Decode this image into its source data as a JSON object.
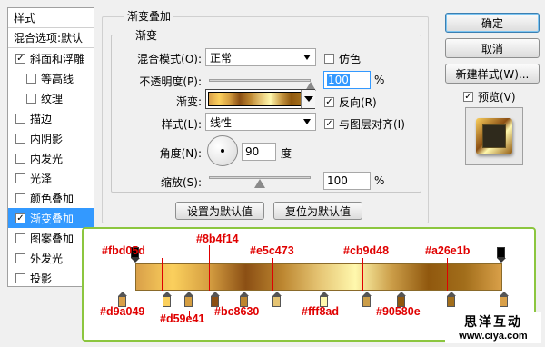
{
  "left_panel": {
    "header": "样式",
    "blend_defaults": "混合选项:默认",
    "items": [
      {
        "label": "斜面和浮雕",
        "checked": "✓",
        "sub": false
      },
      {
        "label": "等高线",
        "checked": "",
        "sub": true
      },
      {
        "label": "纹理",
        "checked": "",
        "sub": true
      },
      {
        "label": "描边",
        "checked": "",
        "sub": false
      },
      {
        "label": "内阴影",
        "checked": "",
        "sub": false
      },
      {
        "label": "内发光",
        "checked": "",
        "sub": false
      },
      {
        "label": "光泽",
        "checked": "",
        "sub": false
      },
      {
        "label": "颜色叠加",
        "checked": "",
        "sub": false
      },
      {
        "label": "渐变叠加",
        "checked": "✓",
        "sub": false,
        "selected": true
      },
      {
        "label": "图案叠加",
        "checked": "",
        "sub": false
      },
      {
        "label": "外发光",
        "checked": "",
        "sub": false
      },
      {
        "label": "投影",
        "checked": "",
        "sub": false
      }
    ]
  },
  "gradient_overlay": {
    "title": "渐变叠加",
    "group_title": "渐变",
    "blend_mode_label": "混合模式(O):",
    "blend_mode_value": "正常",
    "dither_label": "仿色",
    "dither_checked": "",
    "opacity_label": "不透明度(P):",
    "opacity_value": "100",
    "opacity_unit": "%",
    "opacity_level": 1.0,
    "gradient_label": "渐变:",
    "reverse_label": "反向(R)",
    "reverse_checked": "✓",
    "style_label": "样式(L):",
    "style_value": "线性",
    "align_label": "与图层对齐(I)",
    "align_checked": "✓",
    "angle_label": "角度(N):",
    "angle_value": "90",
    "angle_unit": "度",
    "scale_label": "缩放(S):",
    "scale_value": "100",
    "scale_unit": "%",
    "scale_level": 0.5,
    "make_default": "设置为默认值",
    "reset_default": "复位为默认值"
  },
  "right_panel": {
    "ok": "确定",
    "cancel": "取消",
    "new_style": "新建样式(W)...",
    "preview_label": "预览(V)",
    "preview_checked": "✓"
  },
  "gradient_editor": {
    "top_labels": [
      "#fbd05d",
      "#8b4f14",
      "#e5c473",
      "#cb9d48",
      "#a26e1b"
    ],
    "bottom_labels": [
      "#d9a049",
      "#d59e41",
      "#bc8630",
      "#fff8ad",
      "#90580e"
    ],
    "color_stops": [
      "#d9a049",
      "#fbd05d",
      "#d59e41",
      "#8b4f14",
      "#bc8630",
      "#e5c473",
      "#fff8ad",
      "#cb9d48",
      "#90580e",
      "#a26e1b",
      "#d9a049"
    ],
    "gradient_colors": [
      "#d9a049",
      "#fbd05d",
      "#d59e41",
      "#8b4f14",
      "#bc8630",
      "#e5c473",
      "#fff8ad",
      "#cb9d48",
      "#90580e",
      "#a26e1b",
      "#d9a049"
    ]
  },
  "watermark": {
    "title": "思洋互动",
    "url": "www.ciya.com"
  }
}
